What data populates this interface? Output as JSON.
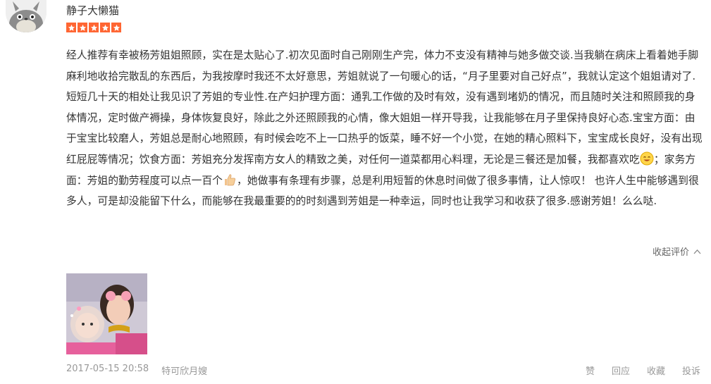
{
  "review": {
    "username": "静子大懒猫",
    "rating_stars": 5,
    "rating_color": "#ff6633",
    "text_part1": "经人推荐有幸被杨芳姐姐照顾，实在是太贴心了.初次见面时自己刚刚生产完，体力不支没有精神与她多做交谈.当我躺在病床上看着她手脚麻利地收拾完散乱的东西后，为我按摩时我还不太好意思，芳姐就说了一句暖心的话，“月子里要对自己好点”，我就认定这个姐姐请对了. 短短几十天的相处让我见识了芳姐的专业性.在产妇护理方面：通乳工作做的及时有效，没有遇到堵奶的情况，而且随时关注和照顾我的身体情况，定时做产褥操，身体恢复良好，除此之外还照顾我的心情，像大姐姐一样开导我，让我能够在月子里保持良好心态.宝宝方面：由于宝宝比较磨人，芳姐总是耐心地照顾，有时候会吃不上一口热乎的饭菜，睡不好一个小觉，在她的精心照料下，宝宝成长良好，没有出现红屁屁等情况；饮食方面：芳姐充分发挥南方女人的精致之美，对任何一道菜都用心料理，无论是三餐还是加餐，我都喜欢吃",
    "text_part2": "；家务方面：芳姐的勤劳程度可以点一百个",
    "text_part3": "，她做事有条理有步骤，总是利用短暂的休息时间做了很多事情，让人惊叹！ 也许人生中能够遇到很多人，可是却没能留下什么，而能够在我最重要的的时刻遇到芳姐是一种幸运，同时也让我学习和收获了很多.感谢芳姐！么么哒.",
    "emoji_1": "smile-emoji",
    "emoji_2": "thumbs-up-emoji",
    "collapse_label": "收起评价",
    "date": "2017-05-15 20:58",
    "product": "特可欣月嫂",
    "actions": {
      "like": "赞",
      "reply": "回应",
      "favorite": "收藏",
      "report": "投诉"
    }
  }
}
